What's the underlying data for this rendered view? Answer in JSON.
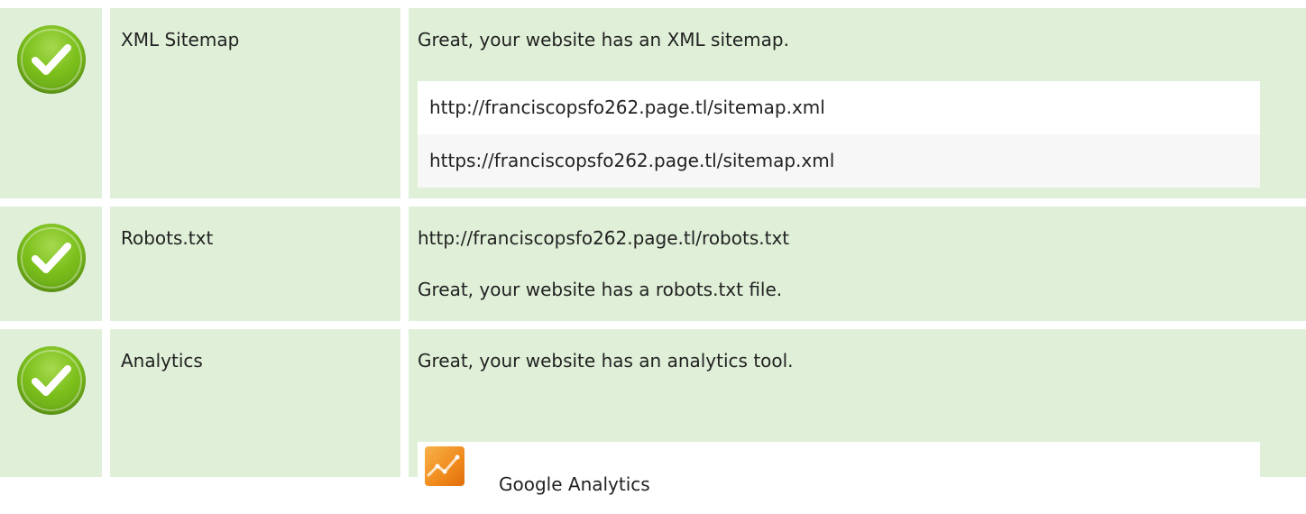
{
  "rows": [
    {
      "label": "XML Sitemap",
      "status_icon": "check-icon",
      "message": "Great, your website has an XML sitemap.",
      "sitemaps": [
        "http://franciscopsfo262.page.tl/sitemap.xml",
        "https://franciscopsfo262.page.tl/sitemap.xml"
      ]
    },
    {
      "label": "Robots.txt",
      "status_icon": "check-icon",
      "url": "http://franciscopsfo262.page.tl/robots.txt",
      "message": "Great, your website has a robots.txt file."
    },
    {
      "label": "Analytics",
      "status_icon": "check-icon",
      "message": "Great, your website has an analytics tool.",
      "tool": {
        "name": "Google Analytics",
        "icon": "google-analytics-icon"
      }
    }
  ],
  "colors": {
    "row_bg": "#e0f0d8",
    "check_green": "#7cc01c",
    "analytics_orange": "#f08a1c"
  }
}
